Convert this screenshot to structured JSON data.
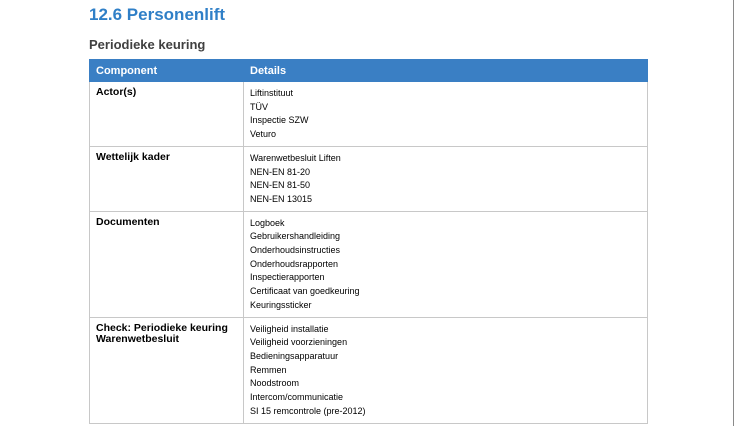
{
  "section_title": "12.6 Personenlift",
  "subsection_title": "Periodieke keuring",
  "table": {
    "headers": [
      "Component",
      "Details"
    ],
    "rows": [
      {
        "component": "Actor(s)",
        "details": [
          "Liftinstituut",
          "TÜV",
          "Inspectie SZW",
          "Veturo"
        ]
      },
      {
        "component": "Wettelijk kader",
        "details": [
          "Warenwetbesluit Liften",
          "NEN-EN 81-20",
          "NEN-EN 81-50",
          "NEN-EN 13015"
        ]
      },
      {
        "component": "Documenten",
        "details": [
          "Logboek",
          "Gebruikershandleiding",
          "Onderhoudsinstructies",
          "Onderhoudsrapporten",
          "Inspectierapporten",
          "Certificaat van goedkeuring",
          "Keuringssticker"
        ]
      },
      {
        "component": "Check: Periodieke keuring Warenwetbesluit",
        "details": [
          "Veiligheid installatie",
          "Veiligheid voorzieningen",
          "Bedieningsapparatuur",
          "Remmen",
          "Noodstroom",
          "Intercom/communicatie",
          "SI 15 remcontrole (pre-2012)"
        ]
      }
    ]
  },
  "colors": {
    "heading": "#2f7fc7",
    "table_header_bg": "#3a7fc4",
    "subheading": "#404040",
    "border": "#c8c8c8"
  }
}
